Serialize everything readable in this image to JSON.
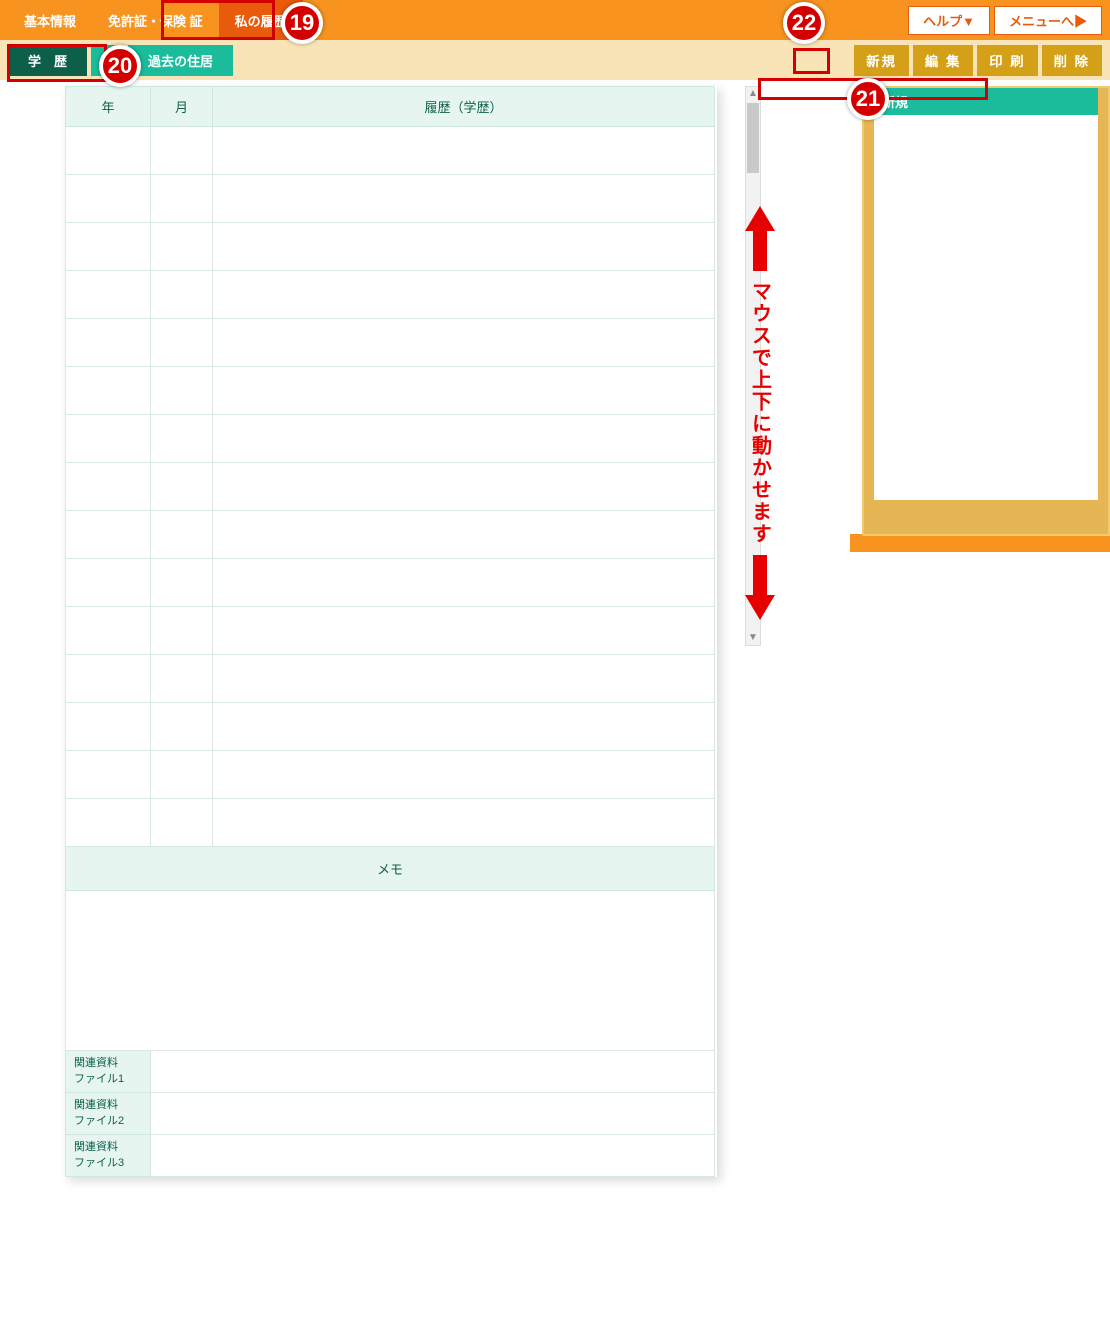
{
  "topTabs": {
    "basic": "基本情報",
    "license": "免許証・保険 証",
    "history": "私の履歴"
  },
  "topButtons": {
    "help": "ヘルプ▼",
    "menu": "メニューへ▶"
  },
  "subTabs": {
    "education": "学　歴",
    "partial": "歴",
    "pastAddress": "過去の住居"
  },
  "actionButtons": {
    "new": "新規",
    "edit": "編 集",
    "print": "印 刷",
    "delete": "削 除"
  },
  "table": {
    "headers": {
      "year": "年",
      "month": "月",
      "history": "履歴（学歴）"
    },
    "rowCount": 15,
    "memoHeader": "メモ",
    "fileLabels": [
      "関連資料\nファイル1",
      "関連資料\nファイル2",
      "関連資料\nファイル3"
    ]
  },
  "sidePanel": {
    "newItem": "新規"
  },
  "annotations": {
    "scrollHint": "マウスで上下に動かせます",
    "badge19": "19",
    "badge20": "20",
    "badge21": "21",
    "badge22": "22"
  }
}
